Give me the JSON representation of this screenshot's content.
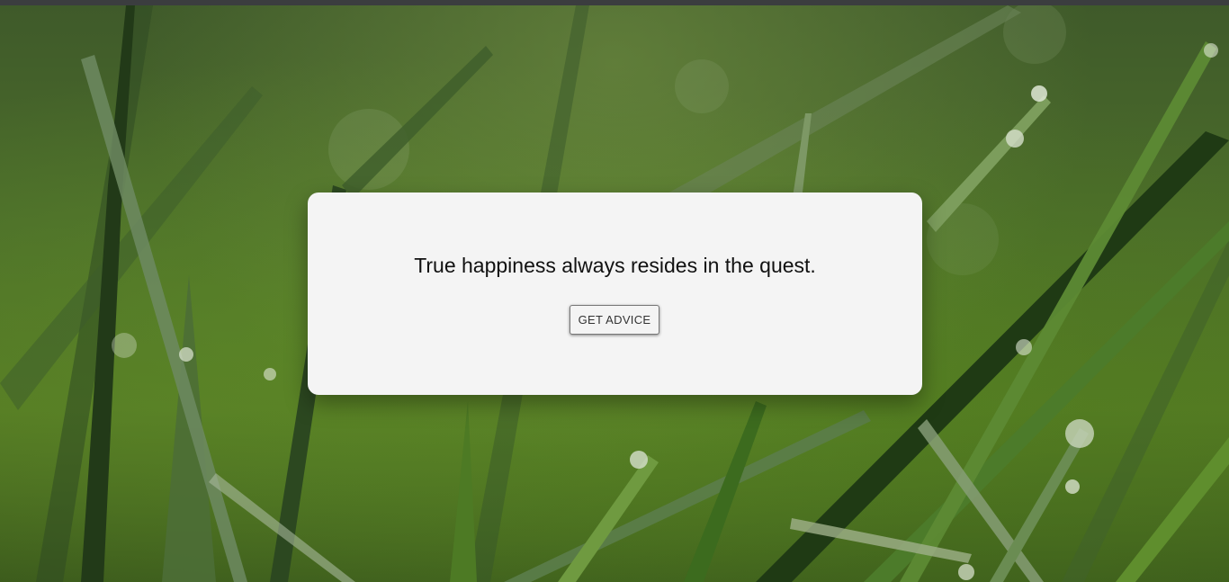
{
  "page": {
    "background_image": "grass-with-dew-drops",
    "accent_color": "#557a24"
  },
  "card": {
    "quote": "True happiness always resides in the quest.",
    "button_label": "GET ADVICE"
  }
}
